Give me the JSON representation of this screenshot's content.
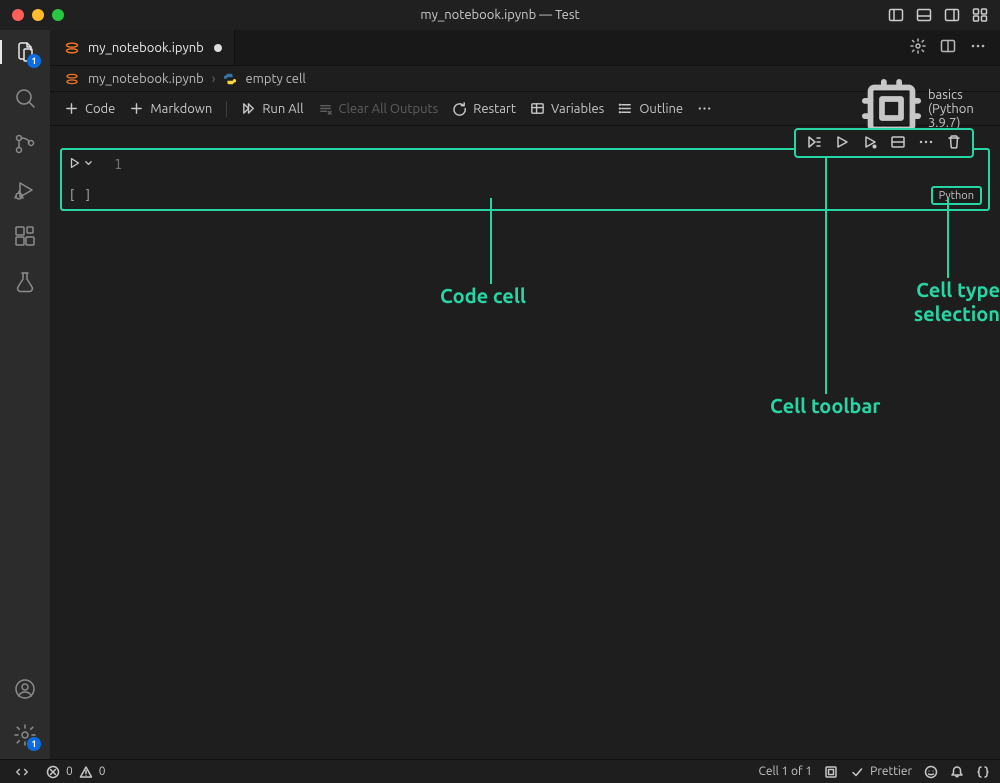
{
  "window": {
    "title": "my_notebook.ipynb — Test"
  },
  "activity": {
    "explorer_badge": "1",
    "settings_badge": "1"
  },
  "tab": {
    "label": "my_notebook.ipynb"
  },
  "breadcrumb": {
    "file": "my_notebook.ipynb",
    "cell": "empty cell"
  },
  "nb_toolbar": {
    "add_code": "Code",
    "add_markdown": "Markdown",
    "run_all": "Run All",
    "clear_outputs": "Clear All Outputs",
    "restart": "Restart",
    "variables": "Variables",
    "outline": "Outline",
    "kernel": "basics (Python 3.9.7)"
  },
  "cell": {
    "line_number": "1",
    "content": "",
    "language_pill": "Python",
    "execution_bracket": "[ ]"
  },
  "annotations": {
    "code_cell": "Code cell",
    "cell_toolbar": "Cell toolbar",
    "cell_type_selection_l1": "Cell type",
    "cell_type_selection_l2": "selection"
  },
  "statusbar": {
    "errors": "0",
    "warnings": "0",
    "cell_pos": "Cell 1 of 1",
    "prettier": "Prettier"
  }
}
